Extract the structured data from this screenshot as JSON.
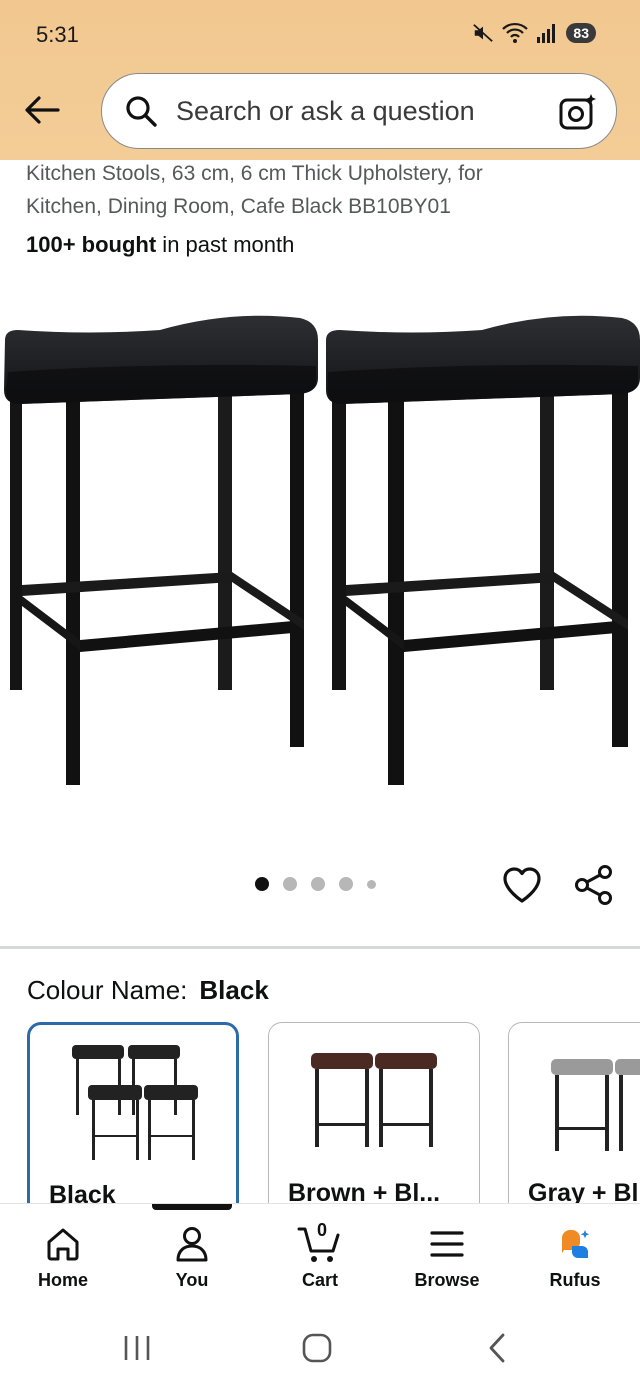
{
  "status_bar": {
    "time": "5:31",
    "battery": "83"
  },
  "search": {
    "placeholder": "Search or ask a question"
  },
  "product": {
    "title_line1": "Kitchen Stools, 63 cm, 6 cm Thick Upholstery, for",
    "title_line2": "Kitchen, Dining Room, Cafe Black BB10BY01",
    "bought_bold": "100+ bought",
    "bought_rest": " in past month"
  },
  "carousel": {
    "total_images": 5,
    "current": 1
  },
  "colour": {
    "label": "Colour Name:",
    "selected": "Black",
    "options": [
      {
        "label": "Black",
        "selected": true
      },
      {
        "label": "Brown + Bl...",
        "selected": false
      },
      {
        "label": "Gray + Bl",
        "selected": false
      }
    ]
  },
  "bottom_nav": {
    "items": [
      {
        "label": "Home",
        "icon": "home-icon"
      },
      {
        "label": "You",
        "icon": "person-icon"
      },
      {
        "label": "Cart",
        "icon": "cart-icon",
        "count": "0"
      },
      {
        "label": "Browse",
        "icon": "menu-icon"
      },
      {
        "label": "Rufus",
        "icon": "rufus-icon"
      }
    ]
  },
  "colors": {
    "header_bg": "#f3cc97",
    "selected_border": "#2d6ba8",
    "rufus_orange": "#f08a24",
    "rufus_blue": "#1d7fe0"
  }
}
